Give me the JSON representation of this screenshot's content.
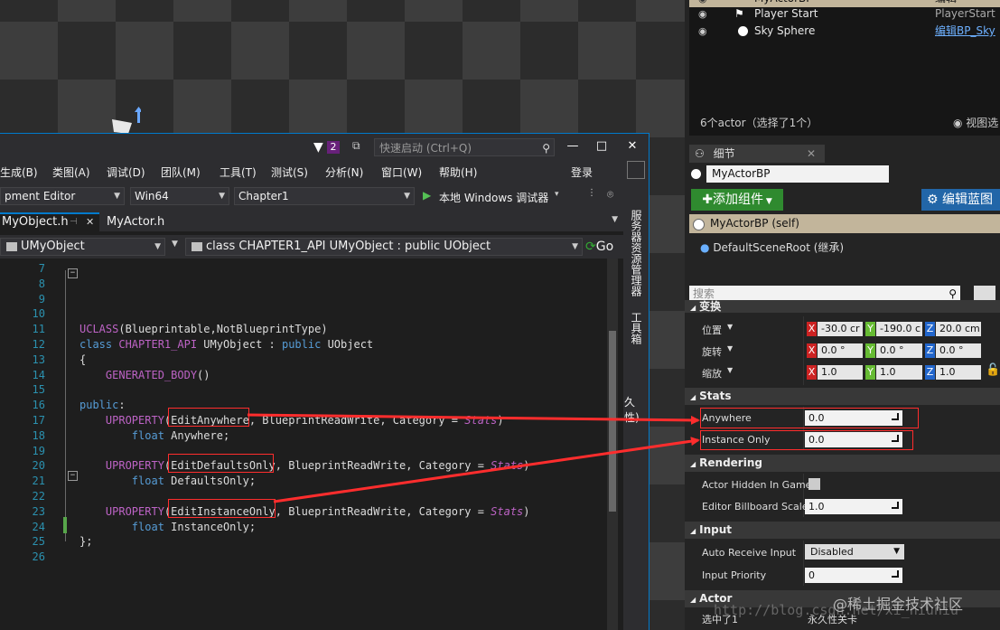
{
  "vs": {
    "notification_count": "2",
    "quick_launch_placeholder": "快速启动 (Ctrl+Q)",
    "menu": [
      "生成(B)",
      "类图(A)",
      "调试(D)",
      "团队(M)",
      "工具(T)",
      "测试(S)",
      "分析(N)",
      "窗口(W)",
      "帮助(H)"
    ],
    "signin": "登录",
    "toolbar": {
      "config": "pment Editor",
      "platform": "Win64",
      "project": "Chapter1",
      "run": "本地 Windows 调试器"
    },
    "tabs": [
      {
        "label": "MyObject.h",
        "active": true
      },
      {
        "label": "MyActor.h",
        "active": false
      }
    ],
    "nav": {
      "scope": "UMyObject",
      "member": "class CHAPTER1_API UMyObject : public UObject",
      "go": "Go"
    },
    "side_panels": [
      "服务器资源管理器",
      "工具箱"
    ],
    "peek_text": "久性)",
    "code_lines": [
      {
        "n": "7",
        "t": ""
      },
      {
        "n": "8",
        "t": "/**"
      },
      {
        "n": "9",
        "t": " *"
      },
      {
        "n": "10",
        "t": " */"
      },
      {
        "n": "11",
        "t": "UCLASS(Blueprintable,NotBlueprintType)"
      },
      {
        "n": "12",
        "t": "class CHAPTER1_API UMyObject : public UObject"
      },
      {
        "n": "13",
        "t": "{"
      },
      {
        "n": "14",
        "t": "    GENERATED_BODY()"
      },
      {
        "n": "15",
        "t": ""
      },
      {
        "n": "16",
        "t": "public:"
      },
      {
        "n": "17",
        "t": "    UPROPERTY(EditAnywhere, BlueprintReadWrite, Category = Stats)"
      },
      {
        "n": "18",
        "t": "        float Anywhere;"
      },
      {
        "n": "19",
        "t": ""
      },
      {
        "n": "20",
        "t": "    UPROPERTY(EditDefaultsOnly, BlueprintReadWrite, Category = Stats)"
      },
      {
        "n": "21",
        "t": "        float DefaultsOnly;"
      },
      {
        "n": "22",
        "t": ""
      },
      {
        "n": "23",
        "t": "    UPROPERTY(EditInstanceOnly, BlueprintReadWrite, Category = Stats)"
      },
      {
        "n": "24",
        "t": "        float InstanceOnly;"
      },
      {
        "n": "25",
        "t": "};"
      },
      {
        "n": "26",
        "t": ""
      }
    ]
  },
  "ue": {
    "outliner": [
      {
        "label": "MyActorBP",
        "type": "编辑MyActorB"
      },
      {
        "label": "Player Start",
        "type": "PlayerStart"
      },
      {
        "label": "Sky Sphere",
        "type": "编辑BP_Sky"
      }
    ],
    "outliner_count": "6个actor（选择了1个）",
    "view_options": "视图选",
    "details_tab": "细节",
    "actor_name": "MyActorBP",
    "add_component": "添加组件",
    "edit_blueprint": "编辑蓝图",
    "self_component": "MyActorBP (self)",
    "scene_root": "DefaultSceneRoot (继承)",
    "search_placeholder": "搜索",
    "transform": {
      "header": "变换",
      "location_label": "位置",
      "rotation_label": "旋转",
      "scale_label": "缩放",
      "location": [
        "-30.0 cr",
        "-190.0 c",
        "20.0 cm"
      ],
      "rotation": [
        "0.0 °",
        "0.0 °",
        "0.0 °"
      ],
      "scale": [
        "1.0",
        "1.0",
        "1.0"
      ],
      "axis": [
        "X",
        "Y",
        "Z"
      ]
    },
    "stats": {
      "header": "Stats",
      "rows": [
        {
          "label": "Anywhere",
          "value": "0.0"
        },
        {
          "label": "Instance Only",
          "value": "0.0"
        }
      ]
    },
    "rendering": {
      "header": "Rendering",
      "hidden_label": "Actor Hidden In Game",
      "billboard_label": "Editor Billboard Scale",
      "billboard_value": "1.0"
    },
    "input": {
      "header": "Input",
      "auto_receive_label": "Auto Receive Input",
      "auto_receive_value": "Disabled",
      "priority_label": "Input Priority",
      "priority_value": "0"
    },
    "actor": {
      "header": "Actor",
      "selected_label": "选中了1",
      "selected_value": "永久性关卡"
    }
  },
  "watermark": "@稀土掘金技术社区",
  "watermark_url": "http://blog.csdn.net/xi_niuniu",
  "colors": {
    "accent": "#007acc",
    "highlight": "#ff2d2d",
    "add_green": "#2f8a2f",
    "edit_blue": "#2266a8"
  }
}
